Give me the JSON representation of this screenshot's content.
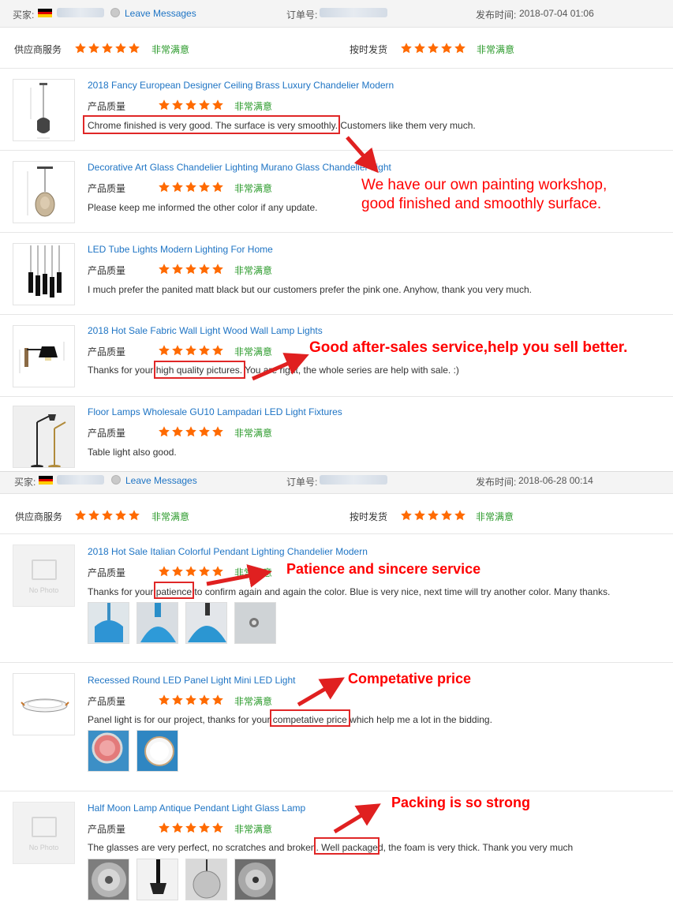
{
  "labels": {
    "buyer": "买家:",
    "leave_messages": "Leave Messages",
    "order_no": "订单号:",
    "published": "发布时间:",
    "supplier_service": "供应商服务",
    "on_time_delivery": "按时发货",
    "product_quality": "产品质量",
    "very_satisfied": "非常满意",
    "no_photo": "No Photo"
  },
  "reviews": [
    {
      "publish_time": "2018-07-04 01:06",
      "supplier_rating": 5,
      "delivery_rating": 5,
      "items": [
        {
          "title": "2018 Fancy European Designer Ceiling Brass Luxury Chandelier Modern",
          "rating": 5,
          "comment": "Chrome finished is very good. The surface is very smoothly. Customers like them very much."
        },
        {
          "title": "Decorative Art Glass Chandelier Lighting Murano Glass Chandelier Light",
          "rating": 5,
          "comment": "Please keep me informed the other color if any update."
        },
        {
          "title": "LED Tube Lights Modern Lighting For Home",
          "rating": 5,
          "comment": "I much prefer the panited matt black but our customers prefer the pink one. Anyhow, thank you very much."
        },
        {
          "title": "2018 Hot Sale Fabric Wall Light Wood Wall Lamp Lights",
          "rating": 5,
          "comment": "Thanks for your high quality pictures. You are right, the whole series are help with sale. :)"
        },
        {
          "title": "Floor Lamps Wholesale GU10 Lampadari LED Light Fixtures",
          "rating": 5,
          "comment": "Table light also good."
        }
      ]
    },
    {
      "publish_time": "2018-06-28 00:14",
      "supplier_rating": 5,
      "delivery_rating": 5,
      "items": [
        {
          "title": "2018 Hot Sale Italian Colorful Pendant Lighting Chandelier Modern",
          "rating": 5,
          "comment": "Thanks for your patience to confirm again and again the color. Blue is very nice, next time will try another color. Many thanks."
        },
        {
          "title": "Recessed Round LED Panel Light Mini LED Light",
          "rating": 5,
          "comment": "Panel light is for our project, thanks for your competative price which help me a lot in the bidding."
        },
        {
          "title": "Half Moon Lamp Antique Pendant Light Glass Lamp",
          "rating": 5,
          "comment": "The glasses are very perfect, no scratches and broken. Well packaged, the foam is very thick. Thank you very much"
        }
      ]
    }
  ],
  "annotations": {
    "painting": "We have our own painting workshop,",
    "painting_2": "good finished and smoothly surface.",
    "after_sales": "Good after-sales service,help you sell better.",
    "patience": "Patience and sincere service",
    "price": "Competative price",
    "packing": "Packing is so strong"
  },
  "colors": {
    "star": "#ff6a00",
    "satisfied_text": "#2a9a2a",
    "link": "#1e74c4",
    "annotation": "#ff0000",
    "highlight_box": "#e02727",
    "header_bg": "#f4f4f4"
  },
  "icons": {
    "flag": "germany-flag-icon",
    "message": "message-icon",
    "star": "star-icon",
    "no_photo": "image-placeholder-icon"
  }
}
